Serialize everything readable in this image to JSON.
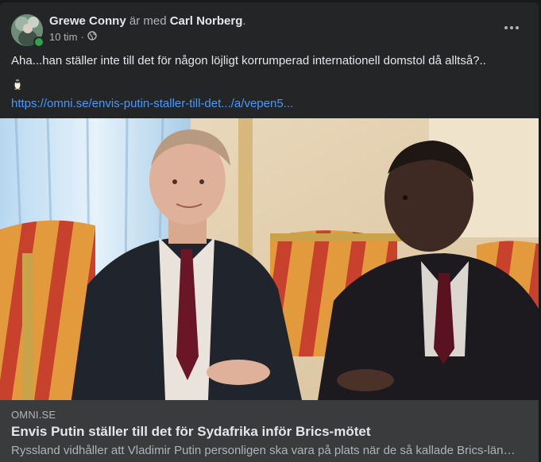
{
  "post": {
    "author": "Grewe Conny",
    "with_text": "är med",
    "tagged": "Carl Norberg",
    "period": ".",
    "time": "10 tim",
    "separator": "·",
    "privacy_icon": "globe-icon",
    "text": "Aha...han ställer inte till det för någon löjligt korrumperad internationell domstol då alltså?..",
    "emoji": "penguin-emoji",
    "link": "https://omni.se/envis-putin-staller-till-det.../a/vepen5..."
  },
  "link_card": {
    "domain": "OMNI.SE",
    "title": "Envis Putin ställer till det för Sydafrika inför Brics-mötet",
    "description": "Ryssland vidhåller att Vladimir Putin personligen ska vara på plats när de så kallade Brics-länderna"
  },
  "colors": {
    "background": "#18191a",
    "card": "#242526",
    "link": "#4599ff",
    "online": "#31a24c",
    "link_card": "#3a3b3c"
  }
}
